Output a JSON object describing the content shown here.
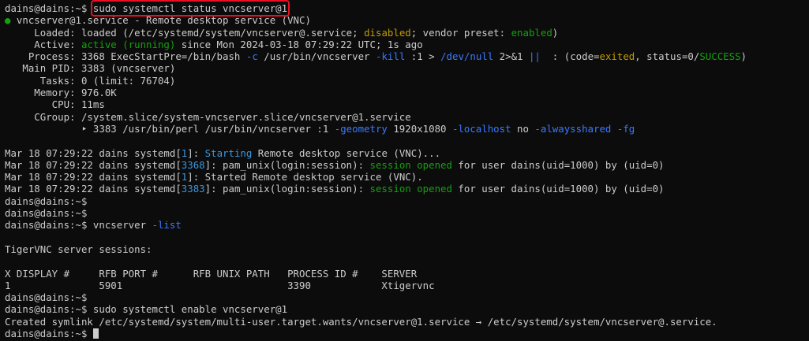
{
  "colors": {
    "background": "#0c0c0c",
    "text": "#cccccc",
    "green": "#13a10e",
    "yellow": "#c19c00",
    "blue": "#3b78ff",
    "cyan": "#3a96dd",
    "highlight_box": "#e81123"
  },
  "terminal": {
    "lines": [
      [
        {
          "t": "dains@dains:~$ "
        },
        {
          "t": "sudo systemctl status vncserver@1",
          "c": "highlight"
        }
      ],
      [
        {
          "t": "● ",
          "c": "green"
        },
        {
          "t": "vncserver@1.service - Remote desktop service (VNC)"
        }
      ],
      [
        {
          "t": "     Loaded: loaded (/etc/systemd/system/vncserver@.service; "
        },
        {
          "t": "disabled",
          "c": "yellow"
        },
        {
          "t": "; vendor preset: "
        },
        {
          "t": "enabled",
          "c": "green"
        },
        {
          "t": ")"
        }
      ],
      [
        {
          "t": "     Active: "
        },
        {
          "t": "active (running)",
          "c": "green"
        },
        {
          "t": " since Mon 2024-03-18 07:29:22 UTC; 1s ago"
        }
      ],
      [
        {
          "t": "    Process: 3368 ExecStartPre=/bin/bash "
        },
        {
          "t": "-c",
          "c": "blue"
        },
        {
          "t": " /usr/bin/vncserver "
        },
        {
          "t": "-kill",
          "c": "blue"
        },
        {
          "t": " :1 > "
        },
        {
          "t": "/dev/null",
          "c": "blue"
        },
        {
          "t": " 2>&1 "
        },
        {
          "t": "||",
          "c": "blue"
        },
        {
          "t": "  : (code="
        },
        {
          "t": "exited",
          "c": "yellow"
        },
        {
          "t": ", status=0/"
        },
        {
          "t": "SUCCESS",
          "c": "green"
        },
        {
          "t": ")"
        }
      ],
      [
        {
          "t": "   Main PID: 3383 (vncserver)"
        }
      ],
      [
        {
          "t": "      Tasks: 0 (limit: 76704)"
        }
      ],
      [
        {
          "t": "     Memory: 976.0K"
        }
      ],
      [
        {
          "t": "        CPU: 11ms"
        }
      ],
      [
        {
          "t": "     CGroup: /system.slice/system-vncserver.slice/vncserver@1.service"
        }
      ],
      [
        {
          "t": "             ‣ 3383 /usr/bin/perl /usr/bin/vncserver :1 "
        },
        {
          "t": "-geometry",
          "c": "blue"
        },
        {
          "t": " 1920x1080 "
        },
        {
          "t": "-localhost",
          "c": "blue"
        },
        {
          "t": " no "
        },
        {
          "t": "-alwaysshared",
          "c": "blue"
        },
        {
          "t": " "
        },
        {
          "t": "-fg",
          "c": "blue"
        }
      ],
      [
        {
          "t": ""
        }
      ],
      [
        {
          "t": "Mar 18 07:29:22 dains systemd["
        },
        {
          "t": "1",
          "c": "cyan"
        },
        {
          "t": "]: "
        },
        {
          "t": "Starting",
          "c": "cyan"
        },
        {
          "t": " Remote desktop service (VNC)..."
        }
      ],
      [
        {
          "t": "Mar 18 07:29:22 dains systemd["
        },
        {
          "t": "3368",
          "c": "cyan"
        },
        {
          "t": "]: pam_unix(login:session): "
        },
        {
          "t": "session opened",
          "c": "green"
        },
        {
          "t": " for user dains(uid=1000) by (uid=0)"
        }
      ],
      [
        {
          "t": "Mar 18 07:29:22 dains systemd["
        },
        {
          "t": "1",
          "c": "cyan"
        },
        {
          "t": "]: Started Remote desktop service (VNC)."
        }
      ],
      [
        {
          "t": "Mar 18 07:29:22 dains systemd["
        },
        {
          "t": "3383",
          "c": "cyan"
        },
        {
          "t": "]: pam_unix(login:session): "
        },
        {
          "t": "session opened",
          "c": "green"
        },
        {
          "t": " for user dains(uid=1000) by (uid=0)"
        }
      ],
      [
        {
          "t": "dains@dains:~$"
        }
      ],
      [
        {
          "t": "dains@dains:~$"
        }
      ],
      [
        {
          "t": "dains@dains:~$ vncserver "
        },
        {
          "t": "-list",
          "c": "blue"
        }
      ],
      [
        {
          "t": ""
        }
      ],
      [
        {
          "t": "TigerVNC server sessions:"
        }
      ],
      [
        {
          "t": ""
        }
      ],
      [
        {
          "t": "X DISPLAY #     RFB PORT #      RFB UNIX PATH   PROCESS ID #    SERVER"
        }
      ],
      [
        {
          "t": "1               5901                            3390            Xtigervnc"
        }
      ],
      [
        {
          "t": "dains@dains:~$"
        }
      ],
      [
        {
          "t": "dains@dains:~$ sudo systemctl enable vncserver@1"
        }
      ],
      [
        {
          "t": "Created symlink /etc/systemd/system/multi-user.target.wants/vncserver@1.service → /etc/systemd/system/vncserver@.service."
        }
      ],
      [
        {
          "t": "dains@dains:~$ "
        }
      ]
    ]
  }
}
